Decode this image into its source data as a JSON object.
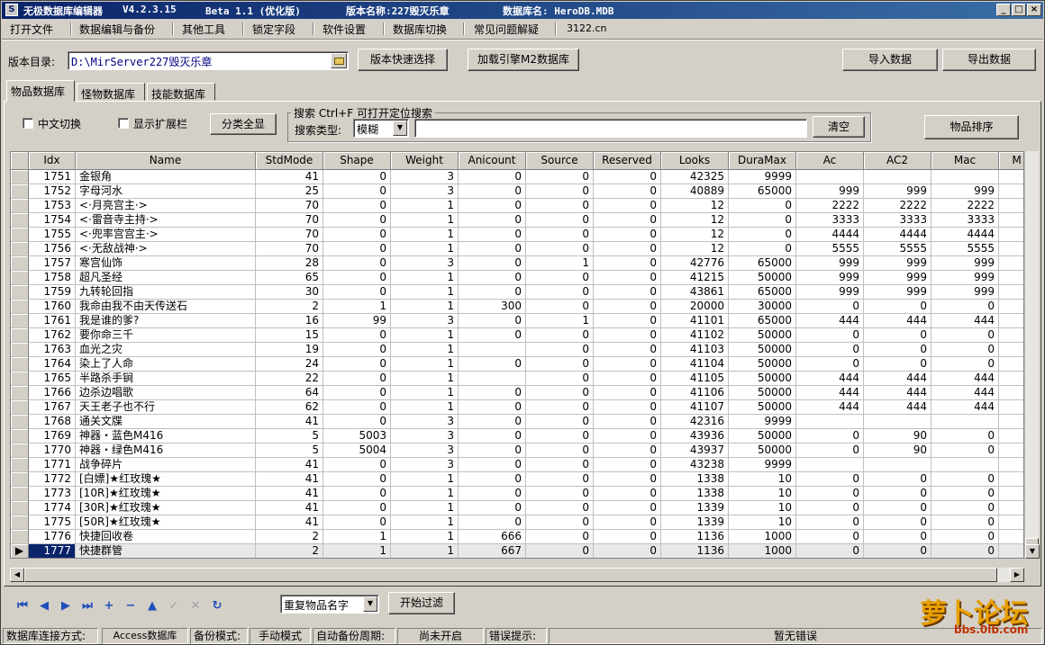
{
  "window": {
    "title_app": "无极数据库编辑器",
    "version": "V4.2.3.15",
    "edition": "Beta 1.1 (优化版)",
    "version_name_label": "版本名称:227毁灭乐章",
    "db_name_label": "数据库名: HeroDB.MDB",
    "icon": "app-icon",
    "controls": [
      "_",
      "□",
      "×"
    ]
  },
  "menu": [
    "打开文件",
    "数据编辑与备份",
    "其他工具",
    "锁定字段",
    "软件设置",
    "数据库切换",
    "常见问题解疑",
    "3122.cn"
  ],
  "toolbar": {
    "dir_label": "版本目录:",
    "dir_value": "D:\\MirServer227毁灭乐章",
    "quick_select": "版本快速选择",
    "load_engine": "加载引擎M2数据库",
    "import": "导入数据",
    "export": "导出数据"
  },
  "tabs": [
    "物品数据库",
    "怪物数据库",
    "技能数据库"
  ],
  "filters": {
    "cn_switch": "中文切换",
    "show_ext": "显示扩展栏",
    "show_all": "分类全显",
    "search_title": "搜索  Ctrl+F 可打开定位搜索",
    "search_type_label": "搜索类型:",
    "search_type_value": "模糊",
    "search_value": "",
    "clear": "清空",
    "sort": "物品排序"
  },
  "table": {
    "columns": [
      "Idx",
      "Name",
      "StdMode",
      "Shape",
      "Weight",
      "Anicount",
      "Source",
      "Reserved",
      "Looks",
      "DuraMax",
      "Ac",
      "AC2",
      "Mac",
      "M"
    ],
    "rows": [
      [
        "1751",
        "金银角",
        "41",
        "0",
        "3",
        "0",
        "0",
        "0",
        "42325",
        "9999",
        "",
        "",
        ""
      ],
      [
        "1752",
        "字母河水",
        "25",
        "0",
        "3",
        "0",
        "0",
        "0",
        "40889",
        "65000",
        "999",
        "999",
        "999"
      ],
      [
        "1753",
        "<·月亮宫主·>",
        "70",
        "0",
        "1",
        "0",
        "0",
        "0",
        "12",
        "0",
        "2222",
        "2222",
        "2222"
      ],
      [
        "1754",
        "<·雷音寺主持·>",
        "70",
        "0",
        "1",
        "0",
        "0",
        "0",
        "12",
        "0",
        "3333",
        "3333",
        "3333"
      ],
      [
        "1755",
        "<·兜率宫宫主·>",
        "70",
        "0",
        "1",
        "0",
        "0",
        "0",
        "12",
        "0",
        "4444",
        "4444",
        "4444"
      ],
      [
        "1756",
        "<·无敌战神·>",
        "70",
        "0",
        "1",
        "0",
        "0",
        "0",
        "12",
        "0",
        "5555",
        "5555",
        "5555"
      ],
      [
        "1757",
        "寒宫仙饰",
        "28",
        "0",
        "3",
        "0",
        "1",
        "0",
        "42776",
        "65000",
        "999",
        "999",
        "999"
      ],
      [
        "1758",
        "超凡圣经",
        "65",
        "0",
        "1",
        "0",
        "0",
        "0",
        "41215",
        "50000",
        "999",
        "999",
        "999"
      ],
      [
        "1759",
        "九转轮回指",
        "30",
        "0",
        "1",
        "0",
        "0",
        "0",
        "43861",
        "65000",
        "999",
        "999",
        "999"
      ],
      [
        "1760",
        "我命由我不由天传送石",
        "2",
        "1",
        "1",
        "300",
        "0",
        "0",
        "20000",
        "30000",
        "0",
        "0",
        "0"
      ],
      [
        "1761",
        "我是谁的爹?",
        "16",
        "99",
        "3",
        "0",
        "1",
        "0",
        "41101",
        "65000",
        "444",
        "444",
        "444"
      ],
      [
        "1762",
        "要你命三千",
        "15",
        "0",
        "1",
        "0",
        "0",
        "0",
        "41102",
        "50000",
        "0",
        "0",
        "0"
      ],
      [
        "1763",
        "血光之灾",
        "19",
        "0",
        "1",
        "",
        "0",
        "0",
        "41103",
        "50000",
        "0",
        "0",
        "0"
      ],
      [
        "1764",
        "染上了人命",
        "24",
        "0",
        "1",
        "0",
        "0",
        "0",
        "41104",
        "50000",
        "0",
        "0",
        "0"
      ],
      [
        "1765",
        "半路杀手锏",
        "22",
        "0",
        "1",
        "",
        "0",
        "0",
        "41105",
        "50000",
        "444",
        "444",
        "444"
      ],
      [
        "1766",
        "边杀边唱歌",
        "64",
        "0",
        "1",
        "0",
        "0",
        "0",
        "41106",
        "50000",
        "444",
        "444",
        "444"
      ],
      [
        "1767",
        "天王老子也不行",
        "62",
        "0",
        "1",
        "0",
        "0",
        "0",
        "41107",
        "50000",
        "444",
        "444",
        "444"
      ],
      [
        "1768",
        "通关文牒",
        "41",
        "0",
        "3",
        "0",
        "0",
        "0",
        "42316",
        "9999",
        "",
        "",
        ""
      ],
      [
        "1769",
        "神器・蓝色M416",
        "5",
        "5003",
        "3",
        "0",
        "0",
        "0",
        "43936",
        "50000",
        "0",
        "90",
        "0"
      ],
      [
        "1770",
        "神器・绿色M416",
        "5",
        "5004",
        "3",
        "0",
        "0",
        "0",
        "43937",
        "50000",
        "0",
        "90",
        "0"
      ],
      [
        "1771",
        "战争碎片",
        "41",
        "0",
        "3",
        "0",
        "0",
        "0",
        "43238",
        "9999",
        "",
        "",
        ""
      ],
      [
        "1772",
        "[白嫖]★红玫瑰★",
        "41",
        "0",
        "1",
        "0",
        "0",
        "0",
        "1338",
        "10",
        "0",
        "0",
        "0"
      ],
      [
        "1773",
        "[10R]★红玫瑰★",
        "41",
        "0",
        "1",
        "0",
        "0",
        "0",
        "1338",
        "10",
        "0",
        "0",
        "0"
      ],
      [
        "1774",
        "[30R]★红玫瑰★",
        "41",
        "0",
        "1",
        "0",
        "0",
        "0",
        "1339",
        "10",
        "0",
        "0",
        "0"
      ],
      [
        "1775",
        "[50R]★红玫瑰★",
        "41",
        "0",
        "1",
        "0",
        "0",
        "0",
        "1339",
        "10",
        "0",
        "0",
        "0"
      ],
      [
        "1776",
        "快捷回收卷",
        "2",
        "1",
        "1",
        "666",
        "0",
        "0",
        "1136",
        "1000",
        "0",
        "0",
        "0"
      ],
      [
        "1777",
        "快捷群管",
        "2",
        "1",
        "1",
        "667",
        "0",
        "0",
        "1136",
        "1000",
        "0",
        "0",
        "0"
      ]
    ],
    "selected_idx": "1777"
  },
  "navigator": {
    "buttons": [
      "first",
      "prior",
      "next",
      "last",
      "insert",
      "delete",
      "edit",
      "post",
      "cancel",
      "refresh"
    ],
    "glyphs": [
      "⏮",
      "◀",
      "▶",
      "⏭",
      "+",
      "−",
      "▲",
      "✓",
      "✕",
      "↻"
    ],
    "disabled": [
      false,
      false,
      false,
      false,
      false,
      false,
      false,
      true,
      true,
      false
    ],
    "filter_combo": "重复物品名字",
    "filter_btn": "开始过滤"
  },
  "statusbar": {
    "conn_label": "数据库连接方式:",
    "conn_value": "Access数据库",
    "backup_label": "备份模式:",
    "backup_value": "手动模式",
    "auto_label": "自动备份周期:",
    "auto_value": "尚未开启",
    "error_label": "错误提示:",
    "error_value": "暂无错误"
  },
  "watermark": {
    "text": "萝卜论坛",
    "url": "bbs.0lb.com"
  }
}
